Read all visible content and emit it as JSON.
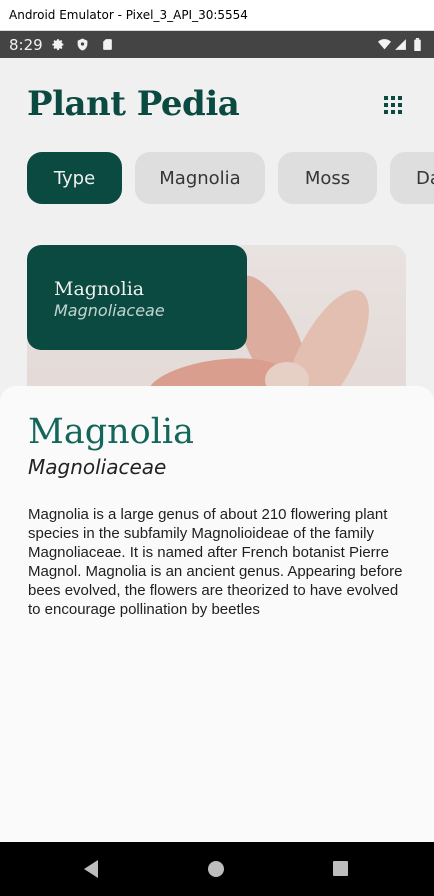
{
  "window": {
    "title": "Android Emulator - Pixel_3_API_30:5554"
  },
  "status_bar": {
    "time": "8:29",
    "icons": [
      "settings-gear-icon",
      "shield-icon",
      "sd-card-icon",
      "wifi-icon",
      "signal-icon",
      "battery-icon"
    ]
  },
  "app": {
    "title": "Plant Pedia",
    "grid_icon": "grid-view-icon",
    "chips": [
      "Type",
      "Magnolia",
      "Moss",
      "Da"
    ],
    "active_chip": "Type",
    "card": {
      "name": "Magnolia",
      "family": "Magnoliaceae"
    }
  },
  "sheet": {
    "title": "Magnolia",
    "subtitle": "Magnoliaceae",
    "description": "Magnolia is a large genus of about 210 flowering plant species in the subfamily Magnolioideae of the family Magnoliaceae. It is named after French botanist Pierre Magnol. Magnolia is an ancient genus. Appearing before bees evolved, the flowers are theorized to have evolved to encourage pollination by beetles"
  },
  "nav_bar": {
    "icons": [
      "back-icon",
      "home-icon",
      "recents-icon"
    ]
  },
  "colors": {
    "primary": "#0b4f45",
    "sheet_title": "#136659",
    "chip_bg": "#ececec",
    "sheet_bg": "#fafafa"
  }
}
